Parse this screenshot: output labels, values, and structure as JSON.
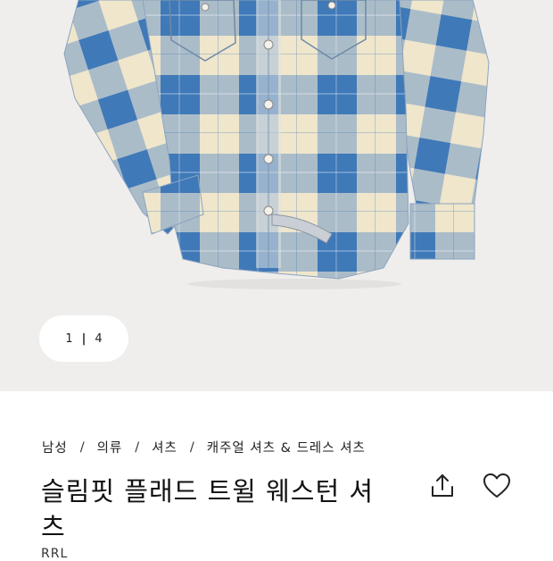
{
  "gallery": {
    "current_page": "1",
    "separator": "|",
    "total_pages": "4",
    "image_name": "plaid-western-shirt-photo"
  },
  "breadcrumb": {
    "items": [
      "남성",
      "의류",
      "셔츠",
      "캐주얼 셔츠 & 드레스 셔츠"
    ],
    "separator": "/"
  },
  "product": {
    "title": "슬림핏 플래드 트윌 웨스턴 셔츠",
    "brand": "RRL"
  },
  "actions": {
    "share_icon": "share-icon",
    "favorite_icon": "heart-icon"
  },
  "colors": {
    "gallery_bg": "#efeeec",
    "plaid_blue": "#3f79b8",
    "plaid_cream": "#efe6cc",
    "plaid_mid": "#9fb5c9"
  }
}
